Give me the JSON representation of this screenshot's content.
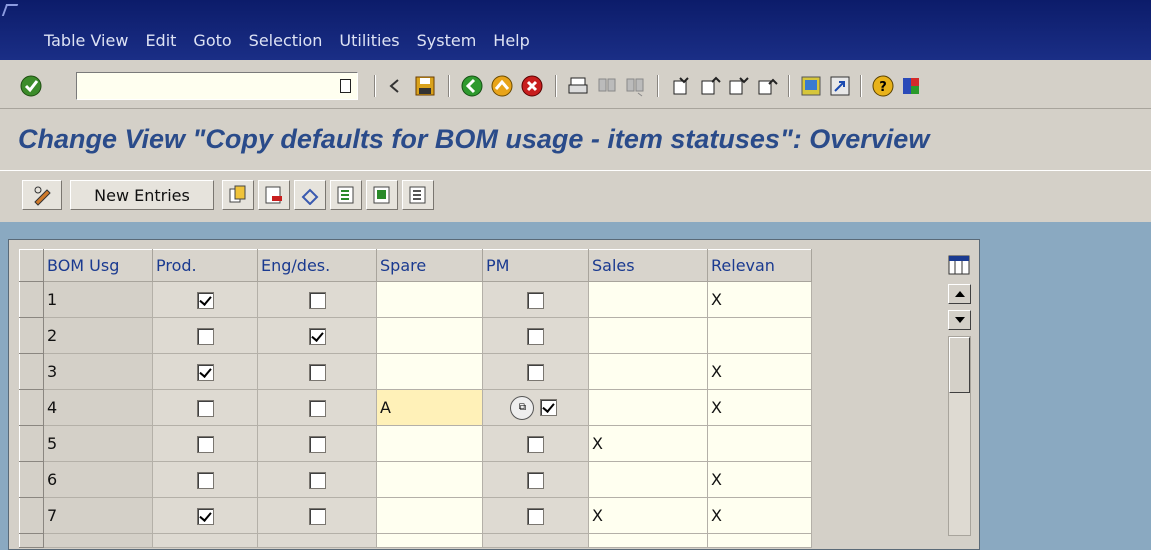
{
  "menu": {
    "items": [
      {
        "label": "Table View"
      },
      {
        "label": "Edit"
      },
      {
        "label": "Goto"
      },
      {
        "label": "Selection"
      },
      {
        "label": "Utilities"
      },
      {
        "label": "System"
      },
      {
        "label": "Help"
      }
    ]
  },
  "toolbar": {
    "command_value": "",
    "icons": [
      "enter-icon",
      "save-icon",
      "back-icon",
      "exit-icon",
      "cancel-icon",
      "print-icon",
      "find-icon",
      "find-next-icon",
      "first-page-icon",
      "previous-page-icon",
      "next-page-icon",
      "last-page-icon",
      "create-session-icon",
      "shortcut-icon",
      "help-icon",
      "customize-layout-icon"
    ]
  },
  "page": {
    "title": "Change View \"Copy defaults for BOM usage - item statuses\": Overview"
  },
  "app_toolbar": {
    "new_entries_label": "New Entries"
  },
  "table": {
    "headers": [
      "BOM Usg",
      "Prod.",
      "Eng/des.",
      "Spare",
      "PM",
      "Sales",
      "Relevan"
    ],
    "rows": [
      {
        "usage": "1",
        "prod": true,
        "eng": false,
        "spare": "",
        "pm": false,
        "sales": "",
        "relevant": "X"
      },
      {
        "usage": "2",
        "prod": false,
        "eng": true,
        "spare": "",
        "pm": false,
        "sales": "",
        "relevant": ""
      },
      {
        "usage": "3",
        "prod": true,
        "eng": false,
        "spare": "",
        "pm": false,
        "sales": "",
        "relevant": "X"
      },
      {
        "usage": "4",
        "prod": false,
        "eng": false,
        "spare": "A",
        "pm": true,
        "sales": "",
        "relevant": "X"
      },
      {
        "usage": "5",
        "prod": false,
        "eng": false,
        "spare": "",
        "pm": false,
        "sales": "X",
        "relevant": ""
      },
      {
        "usage": "6",
        "prod": false,
        "eng": false,
        "spare": "",
        "pm": false,
        "sales": "",
        "relevant": "X"
      },
      {
        "usage": "7",
        "prod": true,
        "eng": false,
        "spare": "",
        "pm": false,
        "sales": "X",
        "relevant": "X"
      }
    ]
  },
  "colors": {
    "menubar": "#0c1c6a",
    "title": "#2a4b8a",
    "header_text": "#1a3a90",
    "content_bg": "#8aa9c1"
  }
}
